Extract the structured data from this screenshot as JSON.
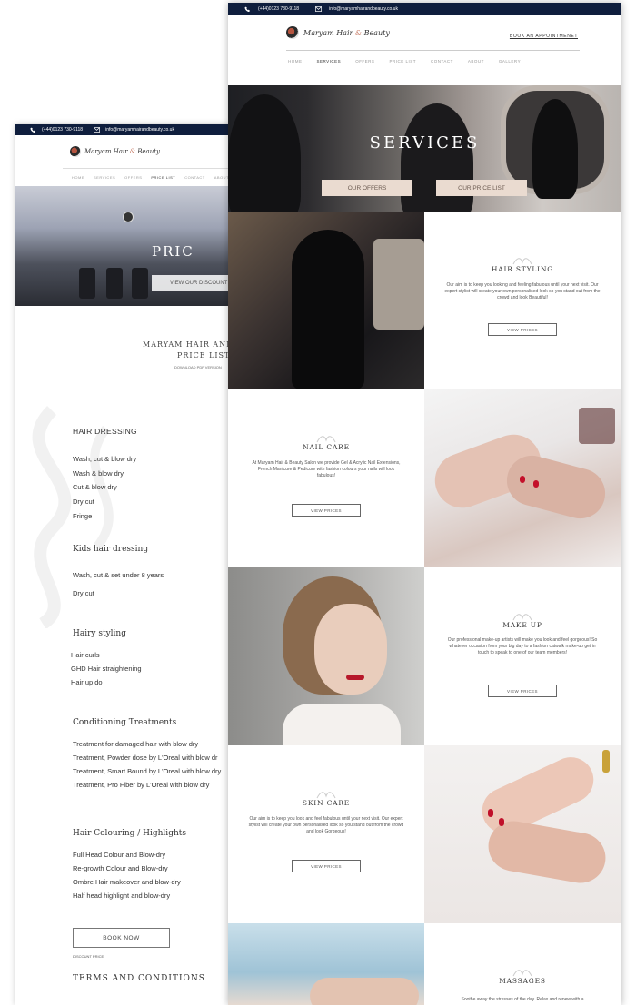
{
  "contact": {
    "phone": "(+44)0123 730-9118",
    "email": "info@maryamhairandbeauty.co.uk"
  },
  "brand": {
    "name": "Maryam Hair",
    "amp": "&",
    "name_end": "Beauty"
  },
  "nav": [
    "HOME",
    "SERVICES",
    "OFFERS",
    "PRICE LIST",
    "CONTACT",
    "ABOUT",
    "GALLERY"
  ],
  "price_page": {
    "hero_title": "PRIC",
    "hero_button": "VIEW OUR DISCOUNT",
    "title_line1": "MARYAM HAIR AND B",
    "title_line2": "PRICE LIST",
    "download": "DOWNLOAD PDF VERSION",
    "categories": [
      {
        "name": "HAIR DRESSING",
        "items": [
          "Wash, cut & blow dry",
          "Wash & blow dry",
          "Cut & blow dry",
          "Dry cut",
          "Fringe"
        ]
      },
      {
        "name": "Kids hair dressing",
        "items": [
          "Wash, cut & set under 8 years",
          "Dry cut"
        ]
      },
      {
        "name": "Hairy styling",
        "items": [
          "Hair curls",
          "GHD Hair straightening",
          "Hair up do"
        ]
      },
      {
        "name": "Conditioning Treatments",
        "items": [
          "Treatment for damaged hair with blow dry",
          "Treatment, Powder dose by L'Oreal with blow dr",
          "Treatment, Smart Bound by L'Oreal with blow dry",
          "Treatment, Pro Fiber by L'Oreal with blow dry"
        ]
      },
      {
        "name": "Hair Colouring / Highlights",
        "items": [
          "Full Head Colour and Blow-dry",
          "Re-growth Colour and Blow-dry",
          "Ombre Hair makeover and blow-dry",
          "Half head highlight and blow-dry"
        ]
      }
    ],
    "book_now": "BOOK NOW",
    "discount_note": "DISCOUNT PRICE",
    "terms": "TERMS AND CONDITIONS"
  },
  "services_page": {
    "book_appointment": "BOOK AN APPOINTMENET",
    "hero_title": "SERVICES",
    "offers_button": "OUR OFFERS",
    "pricelist_button": "OUR PRICE LIST",
    "view_prices": "VIEW PRICES",
    "services": [
      {
        "title": "HAIR STYLING",
        "desc": "Our aim is to keep you looking and feeling fabulous until your next visit. Our expert stylist will create your own personalised look so you stand out from the crowd and look Beautiful!"
      },
      {
        "title": "NAIL CARE",
        "desc": "At Maryam Hair & Beauty Salon we provide Gel & Acrylic Nail Extensions, French Manicure & Pedicure with fashion colours your nails will look fabulous!"
      },
      {
        "title": "MAKE UP",
        "desc": "Our professional make-up artists will make you look and feel gorgeous! So whatever occasion from your big day to a fashion catwalk make-up get in touch to speak to one of our team members!"
      },
      {
        "title": "SKIN CARE",
        "desc": "Our aim is to keep you look and feel fabulous until your next visit. Our expert stylist will create your own personalised look so you stand out from the crowd and look Gorgeous!"
      },
      {
        "title": "MASSAGES",
        "desc": "Soothe away the stresses of the day. Relax and renew with a"
      }
    ]
  },
  "colors": {
    "topbar": "#0f1e3d",
    "button_bg": "#eadbd0",
    "accent": "#c97f6a"
  }
}
